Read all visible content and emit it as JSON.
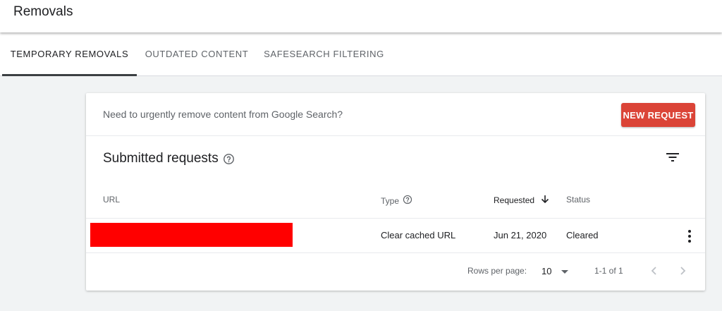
{
  "header": {
    "title": "Removals"
  },
  "tabs": [
    {
      "label": "TEMPORARY REMOVALS",
      "active": true
    },
    {
      "label": "OUTDATED CONTENT",
      "active": false
    },
    {
      "label": "SAFESEARCH FILTERING",
      "active": false
    }
  ],
  "card": {
    "urgent_text": "Need to urgently remove content from Google Search?",
    "new_request_label": "NEW REQUEST",
    "section_title": "Submitted requests",
    "columns": {
      "url": "URL",
      "type": "Type",
      "requested": "Requested",
      "status": "Status"
    },
    "rows": [
      {
        "url": "",
        "type": "Clear cached URL",
        "requested": "Jun 21, 2020",
        "status": "Cleared"
      }
    ],
    "pagination": {
      "rows_per_page_label": "Rows per page:",
      "rows_per_page_value": "10",
      "range": "1-1 of 1"
    }
  },
  "colors": {
    "accent": "#db4437",
    "redaction": "#ff0000",
    "page_background": "#f1f3f4"
  },
  "icons": [
    "help-icon",
    "filter-icon",
    "arrow-down-icon",
    "more-vert-icon",
    "dropdown-icon",
    "chevron-left-icon",
    "chevron-right-icon"
  ]
}
